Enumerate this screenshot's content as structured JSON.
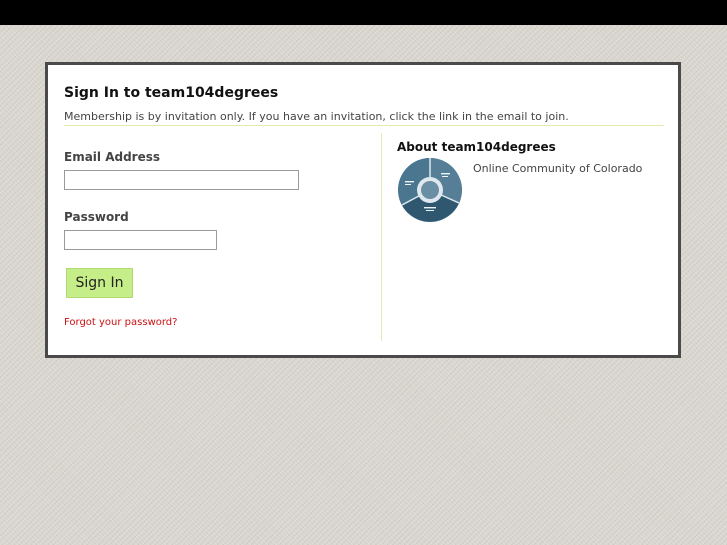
{
  "signin": {
    "title": "Sign In to team104degrees",
    "subtitle": "Membership is by invitation only. If you have an invitation, click the link in the email to join.",
    "email_label": "Email Address",
    "email_value": "",
    "password_label": "Password",
    "password_value": "",
    "button_label": "Sign In",
    "forgot_link": "Forgot your password?"
  },
  "about": {
    "title": "About team104degrees",
    "description": "Online Community of Colorado"
  },
  "colors": {
    "topbar": "#000000",
    "button": "#c6ee88",
    "link": "#cc1111",
    "divider": "#e4edb0"
  }
}
